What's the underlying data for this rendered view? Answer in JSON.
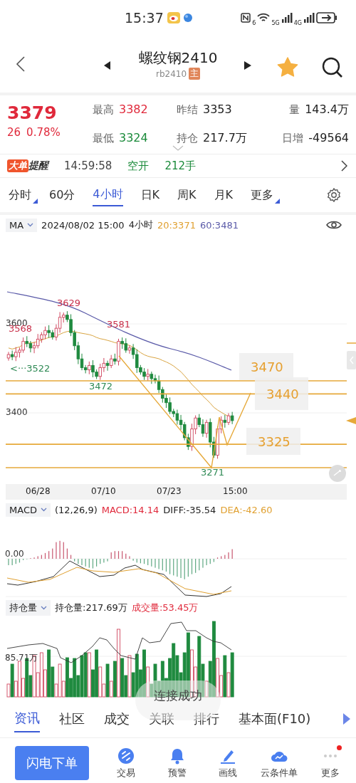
{
  "status_bar": {
    "time": "15:37",
    "wifi_label": "6",
    "networks": [
      "5G",
      "4G"
    ]
  },
  "header": {
    "title": "螺纹钢2410",
    "code": "rb2410",
    "badge": "主",
    "favorite": true
  },
  "quote": {
    "price": "3379",
    "change": "26",
    "change_pct": "0.78%",
    "stats": [
      {
        "label": "最高",
        "value": "3382",
        "color": "#e0293b"
      },
      {
        "label": "昨结",
        "value": "3353",
        "color": "#222222"
      },
      {
        "label": "量",
        "value": "143.4万",
        "color": "#222222"
      },
      {
        "label": "最低",
        "value": "3324",
        "color": "#1a8a3a"
      },
      {
        "label": "持仓",
        "value": "217.7万",
        "color": "#222222"
      },
      {
        "label": "日增",
        "value": "-49564",
        "color": "#222222"
      }
    ]
  },
  "alert": {
    "tag": "大单",
    "title": "提醒",
    "time": "14:59:58",
    "action": "空开",
    "volume": "212手"
  },
  "periods": [
    {
      "label": "分时",
      "selected": false,
      "dropdown": true
    },
    {
      "label": "60分",
      "selected": false,
      "dropdown": false
    },
    {
      "label": "4小时",
      "selected": true,
      "dropdown": false
    },
    {
      "label": "日K",
      "selected": false,
      "dropdown": false
    },
    {
      "label": "周K",
      "selected": false,
      "dropdown": false
    },
    {
      "label": "月K",
      "selected": false,
      "dropdown": false
    },
    {
      "label": "更多",
      "selected": false,
      "dropdown": true
    }
  ],
  "ma_bar": {
    "indicator": "MA",
    "datetime": "2024/08/02 15:00",
    "period": "4小时",
    "values": [
      {
        "text": "20:3371",
        "color": "#e0a030"
      },
      {
        "text": "60:3481",
        "color": "#5a5aa8"
      }
    ]
  },
  "main_chart": {
    "y_labels": [
      "3600",
      "3400"
    ],
    "annotations": [
      {
        "text": "3629",
        "color": "#c8304a"
      },
      {
        "text": "3568",
        "color": "#c8304a"
      },
      {
        "text": "3581",
        "color": "#c8304a"
      },
      {
        "text": "<···3522",
        "color": "#2f8a55"
      },
      {
        "text": "3472",
        "color": "#2f8a55"
      },
      {
        "text": "3271",
        "color": "#2f8a55"
      }
    ],
    "levels": [
      "3470",
      "3440",
      "3325"
    ],
    "x_labels": [
      "06/28",
      "07/10",
      "07/23",
      "15:00"
    ]
  },
  "macd": {
    "indicator": "MACD",
    "params": "(12,26,9)",
    "values": [
      {
        "text": "MACD:14.14",
        "color": "#e0293b"
      },
      {
        "text": "DIFF:-35.54",
        "color": "#222222"
      },
      {
        "text": "DEA:-42.60",
        "color": "#e0a030"
      }
    ],
    "zero_label": "0.00"
  },
  "open_interest": {
    "indicator": "持仓量",
    "values": [
      {
        "text": "持仓量:217.69万",
        "color": "#222222"
      },
      {
        "text": "成交量:53.45万",
        "color": "#e0293b"
      }
    ],
    "axis_label": "85.71万"
  },
  "toast": "连接成功",
  "bottom_tabs": [
    {
      "label": "资讯",
      "selected": true
    },
    {
      "label": "社区",
      "selected": false
    },
    {
      "label": "成交",
      "selected": false
    },
    {
      "label": "关联",
      "selected": false
    },
    {
      "label": "排行",
      "selected": false
    },
    {
      "label": "基本面(F10)",
      "selected": false
    }
  ],
  "actions": {
    "primary": "闪电下单",
    "items": [
      {
        "label": "交易",
        "kind": "trade",
        "dot": false
      },
      {
        "label": "预警",
        "kind": "alert",
        "dot": false
      },
      {
        "label": "画线",
        "kind": "draw",
        "dot": false
      },
      {
        "label": "云条件单",
        "kind": "cloud",
        "dot": false
      },
      {
        "label": "更多",
        "kind": "more",
        "dot": true
      }
    ]
  }
}
